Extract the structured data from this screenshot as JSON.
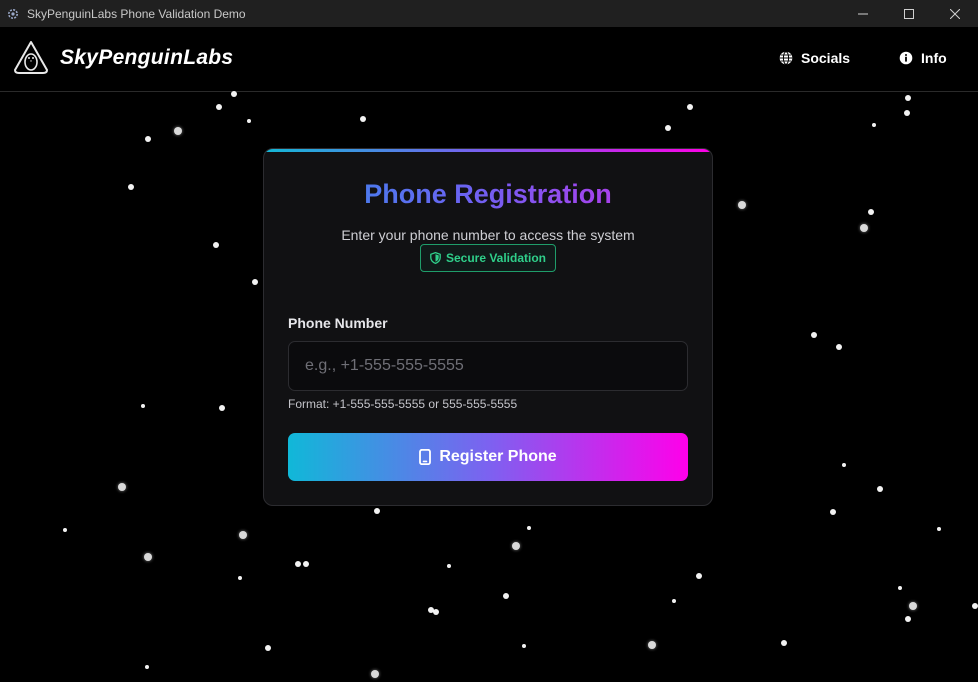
{
  "window": {
    "title": "SkyPenguinLabs Phone Validation Demo",
    "icon": "gear-icon",
    "controls": [
      "minimize-icon",
      "maximize-icon",
      "close-icon"
    ]
  },
  "nav": {
    "brand": "SkyPenguinLabs",
    "links": [
      {
        "label": "Socials",
        "icon": "globe-icon"
      },
      {
        "label": "Info",
        "icon": "info-icon"
      }
    ]
  },
  "card": {
    "title": "Phone Registration",
    "subtitle": "Enter your phone number to access the system",
    "badge": {
      "label": "Secure Validation",
      "icon": "shield-icon"
    },
    "field_label": "Phone Number",
    "input": {
      "value": "",
      "placeholder": "e.g., +1-555-555-5555"
    },
    "hint": "Format: +1-555-555-5555 or 555-555-5555",
    "submit": {
      "label": "Register Phone",
      "icon": "phone-icon"
    }
  },
  "colors": {
    "background": "#000000",
    "card": "#111113",
    "accent_start": "#14b8d6",
    "accent_mid": "#7c5cf0",
    "accent_end": "#ff00e6",
    "badge_green": "#2fcf8a"
  }
}
